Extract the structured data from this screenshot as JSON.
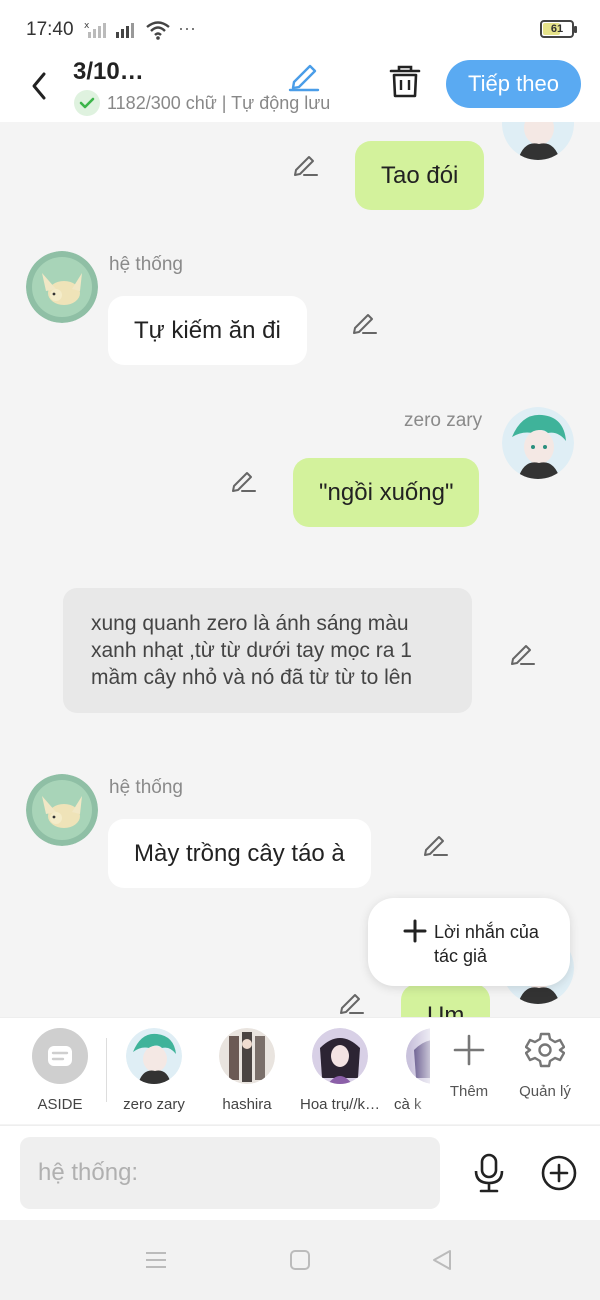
{
  "status": {
    "time": "17:40",
    "extra": "···",
    "battery": "61",
    "battery_level": 0.61
  },
  "header": {
    "title": "3/10…",
    "subtitle": "1182/300 chữ | Tự động lưu",
    "next_label": "Tiếp theo"
  },
  "messages": {
    "m1": {
      "text": "Tao đói"
    },
    "m2": {
      "sender": "hệ thống",
      "text": "Tự kiếm ăn đi"
    },
    "m3": {
      "sender": "zero zary",
      "text": "\"ngồi xuống\""
    },
    "m4": {
      "text": "xung quanh zero là ánh sáng màu xanh nhạt ,từ từ dưới tay mọc ra 1 mầm cây nhỏ và nó đã từ từ to lên"
    },
    "m5": {
      "sender": "hệ thống",
      "text": "Mày trồng cây táo à"
    },
    "m6": {
      "text": "Um"
    }
  },
  "author_note": {
    "label": "Lời nhắn của tác giả"
  },
  "characters": [
    {
      "name": "ASIDE"
    },
    {
      "name": "zero zary"
    },
    {
      "name": "hashira"
    },
    {
      "name": "Hoa trụ//k…"
    },
    {
      "name": "cà k"
    }
  ],
  "tools": {
    "add_label": "Thêm",
    "manage_label": "Quản lý"
  },
  "input": {
    "placeholder": "hệ thống:"
  },
  "colors": {
    "accent": "#5aaaf2",
    "right_bubble": "#d3f29c",
    "left_bubble": "#ffffff",
    "narration": "#e8e8e8"
  }
}
